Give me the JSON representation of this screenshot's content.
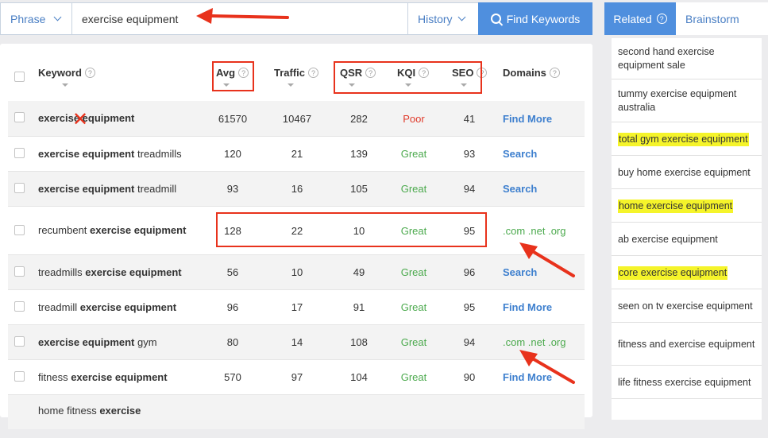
{
  "search": {
    "mode": "Phrase",
    "query": "exercise equipment",
    "history_label": "History",
    "find_label": "Find Keywords"
  },
  "table": {
    "headers": {
      "keyword": "Keyword",
      "avg": "Avg",
      "traffic": "Traffic",
      "qsr": "QSR",
      "kqi": "KQI",
      "seo": "SEO",
      "domains": "Domains"
    },
    "help_glyph": "?",
    "rows": [
      {
        "kw_pre": "",
        "kw_bold": "exercise equipment",
        "kw_post": "",
        "avg": "61570",
        "traffic": "10467",
        "qsr": "282",
        "kqi": "Poor",
        "seo": "41",
        "domains": "Find More"
      },
      {
        "kw_pre": "",
        "kw_bold": "exercise equipment",
        "kw_post": " treadmills",
        "avg": "120",
        "traffic": "21",
        "qsr": "139",
        "kqi": "Great",
        "seo": "93",
        "domains": "Search"
      },
      {
        "kw_pre": "",
        "kw_bold": "exercise equipment",
        "kw_post": " treadmill",
        "avg": "93",
        "traffic": "16",
        "qsr": "105",
        "kqi": "Great",
        "seo": "94",
        "domains": "Search"
      },
      {
        "kw_pre": "recumbent ",
        "kw_bold": "exercise equipment",
        "kw_post": "",
        "avg": "128",
        "traffic": "22",
        "qsr": "10",
        "kqi": "Great",
        "seo": "95",
        "domains": ".com .net .org"
      },
      {
        "kw_pre": "treadmills ",
        "kw_bold": "exercise equipment",
        "kw_post": "",
        "avg": "56",
        "traffic": "10",
        "qsr": "49",
        "kqi": "Great",
        "seo": "96",
        "domains": "Search"
      },
      {
        "kw_pre": "treadmill ",
        "kw_bold": "exercise equipment",
        "kw_post": "",
        "avg": "96",
        "traffic": "17",
        "qsr": "91",
        "kqi": "Great",
        "seo": "95",
        "domains": "Find More"
      },
      {
        "kw_pre": "",
        "kw_bold": "exercise equipment",
        "kw_post": " gym",
        "avg": "80",
        "traffic": "14",
        "qsr": "108",
        "kqi": "Great",
        "seo": "94",
        "domains": ".com .net .org"
      },
      {
        "kw_pre": "fitness ",
        "kw_bold": "exercise equipment",
        "kw_post": "",
        "avg": "570",
        "traffic": "97",
        "qsr": "104",
        "kqi": "Great",
        "seo": "90",
        "domains": "Find More"
      },
      {
        "kw_pre": "home fitness ",
        "kw_bold": "exercise",
        "kw_post": "",
        "avg": "",
        "traffic": "",
        "qsr": "",
        "kqi": "",
        "seo": "",
        "domains": ""
      }
    ]
  },
  "sidebar": {
    "tabs": {
      "related": "Related",
      "brainstorm": "Brainstorm"
    },
    "items": [
      {
        "label": "second hand exercise equipment sale",
        "highlight": false
      },
      {
        "label": "tummy exercise equipment australia",
        "highlight": false
      },
      {
        "label": "total gym exercise equipment",
        "highlight": true
      },
      {
        "label": "buy home exercise equipment",
        "highlight": false
      },
      {
        "label": "home exercise equipment",
        "highlight": true
      },
      {
        "label": "ab exercise equipment",
        "highlight": false
      },
      {
        "label": "core exercise equipment",
        "highlight": true
      },
      {
        "label": "seen on tv exercise equipment",
        "highlight": false
      },
      {
        "label": "fitness and exercise equipment",
        "highlight": false
      },
      {
        "label": "life fitness exercise equipment",
        "highlight": false
      }
    ]
  },
  "colors": {
    "accent": "#4f8fde",
    "great": "#4caa4e",
    "poor": "#e03a2b",
    "annotation_red": "#e8321c",
    "highlight": "#f5f42a"
  }
}
